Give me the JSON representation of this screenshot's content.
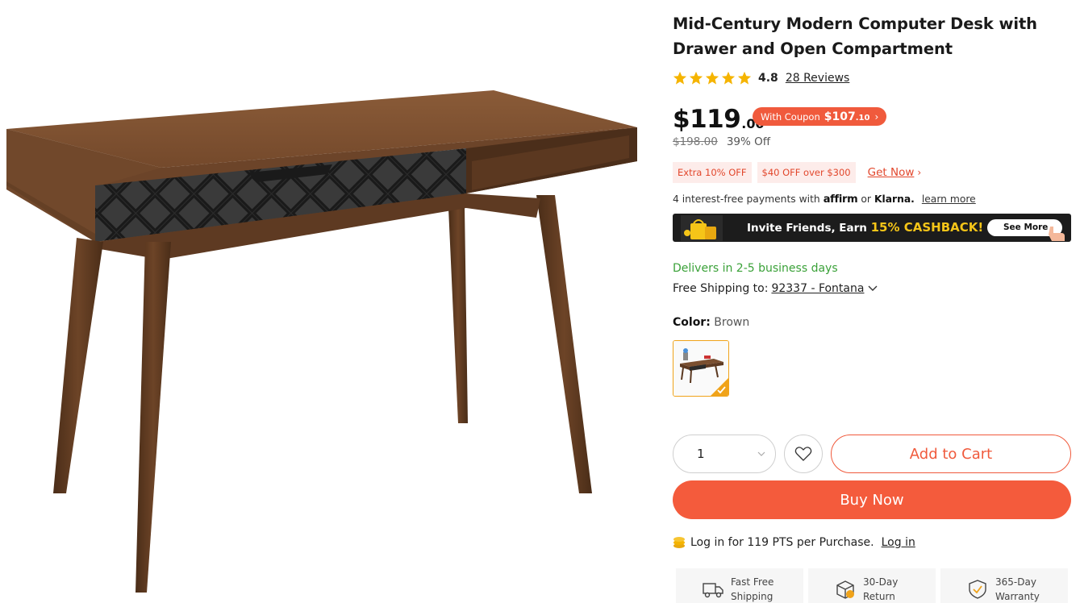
{
  "product": {
    "title": "Mid-Century Modern Computer Desk with Drawer and Open Compartment",
    "rating": "4.8",
    "reviews_label": "28 Reviews",
    "stars_filled": 5,
    "image_alt_icon": "desk-product-image"
  },
  "price": {
    "main": "$119",
    "cents": ".00",
    "coupon_label": "With Coupon",
    "coupon_price": "$107",
    "coupon_cents": ".10",
    "list_price": "$198.00",
    "discount": "39% Off"
  },
  "promos": {
    "tags": [
      "Extra 10% OFF",
      "$40 OFF over $300"
    ],
    "link": "Get Now",
    "link_icon": "chevron-right-icon"
  },
  "financing": {
    "text_before": "4 interest-free payments with",
    "affirm": "affirm",
    "or": "or",
    "klarna": "Klarna.",
    "learn_more": "learn more"
  },
  "banner": {
    "text": "Invite Friends, Earn",
    "highlight": "15% CASHBACK!",
    "button": "See More"
  },
  "shipping": {
    "delivery": "Delivers in 2-5 business days",
    "label": "Free Shipping to:",
    "location": "92337 - Fontana"
  },
  "color": {
    "label": "Color:",
    "value": "Brown"
  },
  "purchase": {
    "quantity": "1",
    "add_to_cart": "Add to Cart",
    "buy_now": "Buy Now"
  },
  "points": {
    "text": "Log in for 119 PTS per Purchase.",
    "login": "Log in"
  },
  "benefits": [
    {
      "icon": "truck-icon",
      "line1": "Fast Free",
      "line2": "Shipping"
    },
    {
      "icon": "return-box-icon",
      "line1": "30-Day",
      "line2": "Return"
    },
    {
      "icon": "shield-check-icon",
      "line1": "365-Day",
      "line2": "Warranty"
    }
  ],
  "colors": {
    "accent": "#f05a3c",
    "success": "#3aa138",
    "wood": "#6b4428",
    "drawer": "#2b2b2b"
  }
}
